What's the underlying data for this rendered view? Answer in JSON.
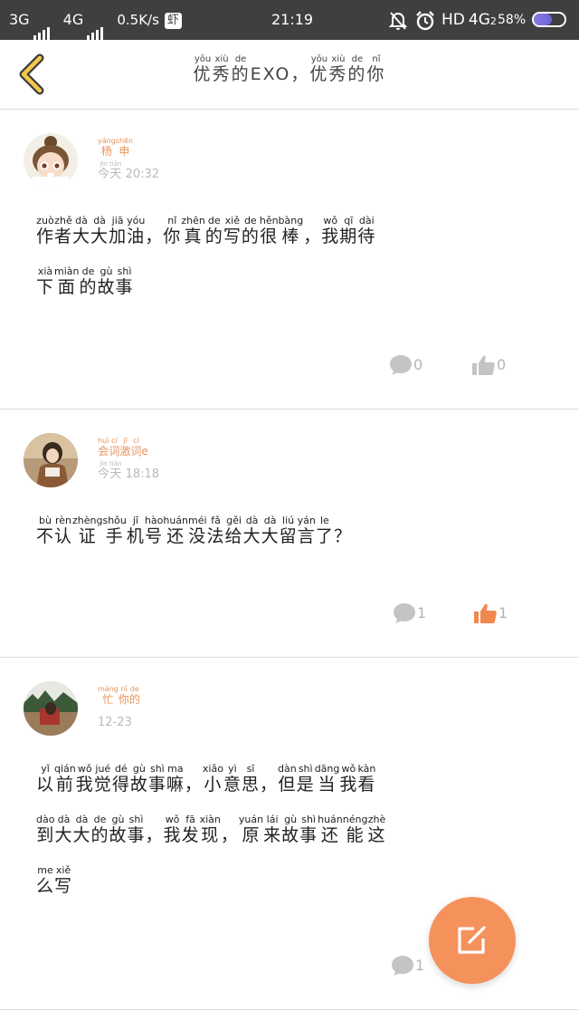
{
  "status_bar": {
    "network1": "3G",
    "network2": "4G",
    "speed": "0.5K/s",
    "shrimp_icon": "虾",
    "time": "21:19",
    "hd": "HD",
    "lte": "4G",
    "sim": "2",
    "battery": "58%",
    "battery_level": 0.58,
    "icons": [
      "notification-off-icon",
      "alarm-icon"
    ]
  },
  "header": {
    "title_chars": [
      {
        "c": "优",
        "p": "yōu"
      },
      {
        "c": "秀",
        "p": "xiù"
      },
      {
        "c": "的",
        "p": "de"
      },
      {
        "c": "EXO",
        "p": ""
      },
      {
        "c": "，",
        "p": ""
      },
      {
        "c": "优",
        "p": "yōu"
      },
      {
        "c": "秀",
        "p": "xiù"
      },
      {
        "c": "的",
        "p": "de"
      },
      {
        "c": "你",
        "p": "nǐ"
      }
    ],
    "back_icon": "chevron-left-icon"
  },
  "comments": [
    {
      "author": [
        {
          "c": "杨",
          "p": "yáng"
        },
        {
          "c": "申",
          "p": "shēn"
        }
      ],
      "date": [
        {
          "c": "今",
          "p": "jīn"
        },
        {
          "c": "天",
          "p": "tiān"
        },
        {
          "c": " 20:32",
          "p": ""
        }
      ],
      "lines": [
        [
          {
            "c": "作",
            "p": "zuò"
          },
          {
            "c": "者",
            "p": "zhě"
          },
          {
            "c": "大",
            "p": "dà"
          },
          {
            "c": "大",
            "p": "dà"
          },
          {
            "c": "加",
            "p": "jiā"
          },
          {
            "c": "油",
            "p": "yóu"
          },
          {
            "c": "，",
            "p": ""
          },
          {
            "c": "你",
            "p": "nǐ"
          },
          {
            "c": "真",
            "p": "zhēn"
          },
          {
            "c": "的",
            "p": "de"
          },
          {
            "c": "写",
            "p": "xiě"
          },
          {
            "c": "的",
            "p": "de"
          },
          {
            "c": "很",
            "p": "hěn"
          },
          {
            "c": "棒",
            "p": "bàng"
          },
          {
            "c": "，",
            "p": ""
          },
          {
            "c": "我",
            "p": "wǒ"
          },
          {
            "c": "期",
            "p": "qī"
          },
          {
            "c": "待",
            "p": "dài"
          }
        ],
        [
          {
            "c": "下",
            "p": "xià"
          },
          {
            "c": "面",
            "p": "miàn"
          },
          {
            "c": "的",
            "p": "de"
          },
          {
            "c": "故",
            "p": "gù"
          },
          {
            "c": "事",
            "p": "shì"
          }
        ]
      ],
      "replies": "0",
      "likes": "0",
      "liked": false
    },
    {
      "author": [
        {
          "c": "会",
          "p": "huì"
        },
        {
          "c": "词",
          "p": "cí"
        },
        {
          "c": "激",
          "p": "jī"
        },
        {
          "c": "词",
          "p": "cí"
        },
        {
          "c": "e",
          "p": ""
        }
      ],
      "date": [
        {
          "c": "今",
          "p": "jīn"
        },
        {
          "c": "天",
          "p": "tiān"
        },
        {
          "c": " 18:18",
          "p": ""
        }
      ],
      "lines": [
        [
          {
            "c": "不",
            "p": "bù"
          },
          {
            "c": "认",
            "p": "rèn"
          },
          {
            "c": "证",
            "p": "zhèng"
          },
          {
            "c": "手",
            "p": "shǒu"
          },
          {
            "c": "机",
            "p": "jī"
          },
          {
            "c": "号",
            "p": "hào"
          },
          {
            "c": "还",
            "p": "huán"
          },
          {
            "c": "没",
            "p": "méi"
          },
          {
            "c": "法",
            "p": "fǎ"
          },
          {
            "c": "给",
            "p": "gěi"
          },
          {
            "c": "大",
            "p": "dà"
          },
          {
            "c": "大",
            "p": "dà"
          },
          {
            "c": "留",
            "p": "liú"
          },
          {
            "c": "言",
            "p": "yán"
          },
          {
            "c": "了",
            "p": "le"
          },
          {
            "c": "？",
            "p": ""
          }
        ]
      ],
      "replies": "1",
      "likes": "1",
      "liked": true
    },
    {
      "author": [
        {
          "c": "忙",
          "p": "máng"
        },
        {
          "c": "你",
          "p": "nǐ"
        },
        {
          "c": "的",
          "p": "de"
        }
      ],
      "date": [
        {
          "c": "12-23",
          "p": ""
        }
      ],
      "lines": [
        [
          {
            "c": "以",
            "p": "yǐ"
          },
          {
            "c": "前",
            "p": "qián"
          },
          {
            "c": "我",
            "p": "wǒ"
          },
          {
            "c": "觉",
            "p": "jué"
          },
          {
            "c": "得",
            "p": "dé"
          },
          {
            "c": "故",
            "p": "gù"
          },
          {
            "c": "事",
            "p": "shì"
          },
          {
            "c": "嘛",
            "p": "ma"
          },
          {
            "c": "，",
            "p": ""
          },
          {
            "c": "小",
            "p": "xiǎo"
          },
          {
            "c": "意",
            "p": "yì"
          },
          {
            "c": "思",
            "p": "sī"
          },
          {
            "c": "，",
            "p": ""
          },
          {
            "c": "但",
            "p": "dàn"
          },
          {
            "c": "是",
            "p": "shì"
          },
          {
            "c": "当",
            "p": "dāng"
          },
          {
            "c": "我",
            "p": "wǒ"
          },
          {
            "c": "看",
            "p": "kàn"
          }
        ],
        [
          {
            "c": "到",
            "p": "dào"
          },
          {
            "c": "大",
            "p": "dà"
          },
          {
            "c": "大",
            "p": "dà"
          },
          {
            "c": "的",
            "p": "de"
          },
          {
            "c": "故",
            "p": "gù"
          },
          {
            "c": "事",
            "p": "shì"
          },
          {
            "c": "，",
            "p": ""
          },
          {
            "c": "我",
            "p": "wǒ"
          },
          {
            "c": "发",
            "p": "fā"
          },
          {
            "c": "现",
            "p": "xiàn"
          },
          {
            "c": "，",
            "p": ""
          },
          {
            "c": "原",
            "p": "yuán"
          },
          {
            "c": "来",
            "p": "lái"
          },
          {
            "c": "故",
            "p": "gù"
          },
          {
            "c": "事",
            "p": "shì"
          },
          {
            "c": "还",
            "p": "huán"
          },
          {
            "c": "能",
            "p": "néng"
          },
          {
            "c": "这",
            "p": "zhè"
          }
        ],
        [
          {
            "c": "么",
            "p": "me"
          },
          {
            "c": "写",
            "p": "xiě"
          }
        ]
      ],
      "replies": "1",
      "likes": "",
      "liked": false
    }
  ],
  "fab": {
    "icon": "edit-icon"
  },
  "colors": {
    "accent": "#f5925c",
    "author": "#e8935c",
    "icon_gray": "#c4c4c4",
    "status_bar": "#3f3f3f"
  }
}
